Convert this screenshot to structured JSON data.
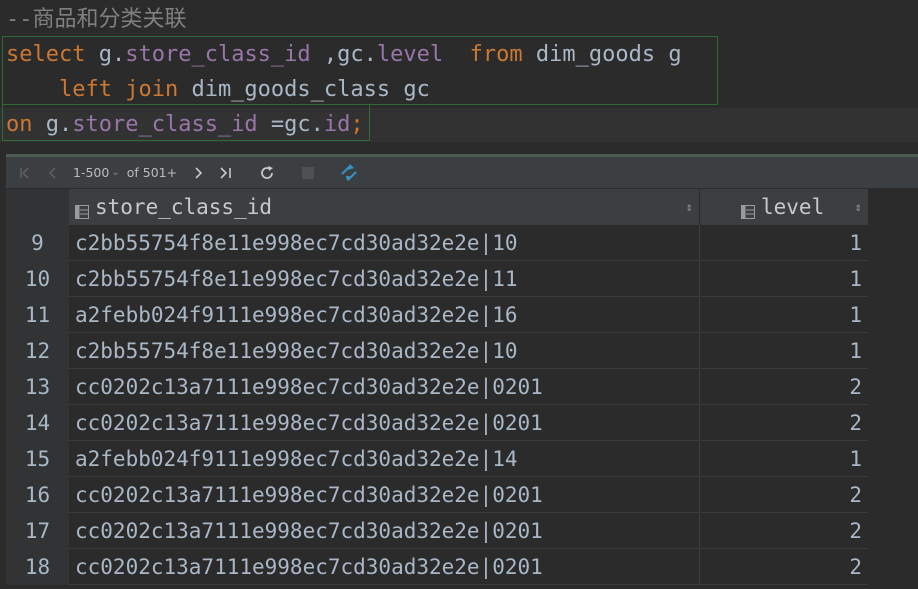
{
  "editor": {
    "comment": "--商品和分类关联",
    "line2": {
      "kw_select": "select",
      "sp1": " g.",
      "f1": "store_class_id",
      "sp2": " ,gc.",
      "f2": "level",
      "sp3": "  ",
      "kw_from": "from",
      "sp4": " dim_goods g"
    },
    "line3": {
      "indent": "    ",
      "kw_left": "left",
      "sp1": " ",
      "kw_join": "join",
      "sp2": " dim_goods_class gc"
    },
    "line4": {
      "kw_on": "on",
      "sp1": " g.",
      "f1": "store_class_id",
      "sp2": " =gc.",
      "f2": "id",
      "end": ";"
    }
  },
  "toolbar": {
    "first_icon": "first-page-icon",
    "prev_icon": "prev-page-icon",
    "page_range": "1-500",
    "page_total": "of 501+",
    "next_icon": "next-page-icon",
    "last_icon": "last-page-icon",
    "refresh_icon": "refresh-icon",
    "stop_icon": "stop-icon",
    "compare_icon": "compare-icon"
  },
  "grid": {
    "columns": [
      {
        "name": "store_class_id",
        "icon": "table-column-icon"
      },
      {
        "name": "level",
        "icon": "table-column-icon"
      }
    ],
    "rows": [
      {
        "n": "9",
        "store_class_id": "c2bb55754f8e11e998ec7cd30ad32e2e|10",
        "level": "1"
      },
      {
        "n": "10",
        "store_class_id": "c2bb55754f8e11e998ec7cd30ad32e2e|11",
        "level": "1"
      },
      {
        "n": "11",
        "store_class_id": "a2febb024f9111e998ec7cd30ad32e2e|16",
        "level": "1"
      },
      {
        "n": "12",
        "store_class_id": "c2bb55754f8e11e998ec7cd30ad32e2e|10",
        "level": "1"
      },
      {
        "n": "13",
        "store_class_id": "cc0202c13a7111e998ec7cd30ad32e2e|0201",
        "level": "2"
      },
      {
        "n": "14",
        "store_class_id": "cc0202c13a7111e998ec7cd30ad32e2e|0201",
        "level": "2"
      },
      {
        "n": "15",
        "store_class_id": "a2febb024f9111e998ec7cd30ad32e2e|14",
        "level": "1"
      },
      {
        "n": "16",
        "store_class_id": "cc0202c13a7111e998ec7cd30ad32e2e|0201",
        "level": "2"
      },
      {
        "n": "17",
        "store_class_id": "cc0202c13a7111e998ec7cd30ad32e2e|0201",
        "level": "2"
      },
      {
        "n": "18",
        "store_class_id": "cc0202c13a7111e998ec7cd30ad32e2e|0201",
        "level": "2"
      }
    ]
  },
  "colors": {
    "background": "#2b2b2b",
    "keyword": "#cc7832",
    "field": "#9876aa",
    "text": "#a9b7c6",
    "comment": "#808080",
    "selection_border": "#2f6b34"
  }
}
